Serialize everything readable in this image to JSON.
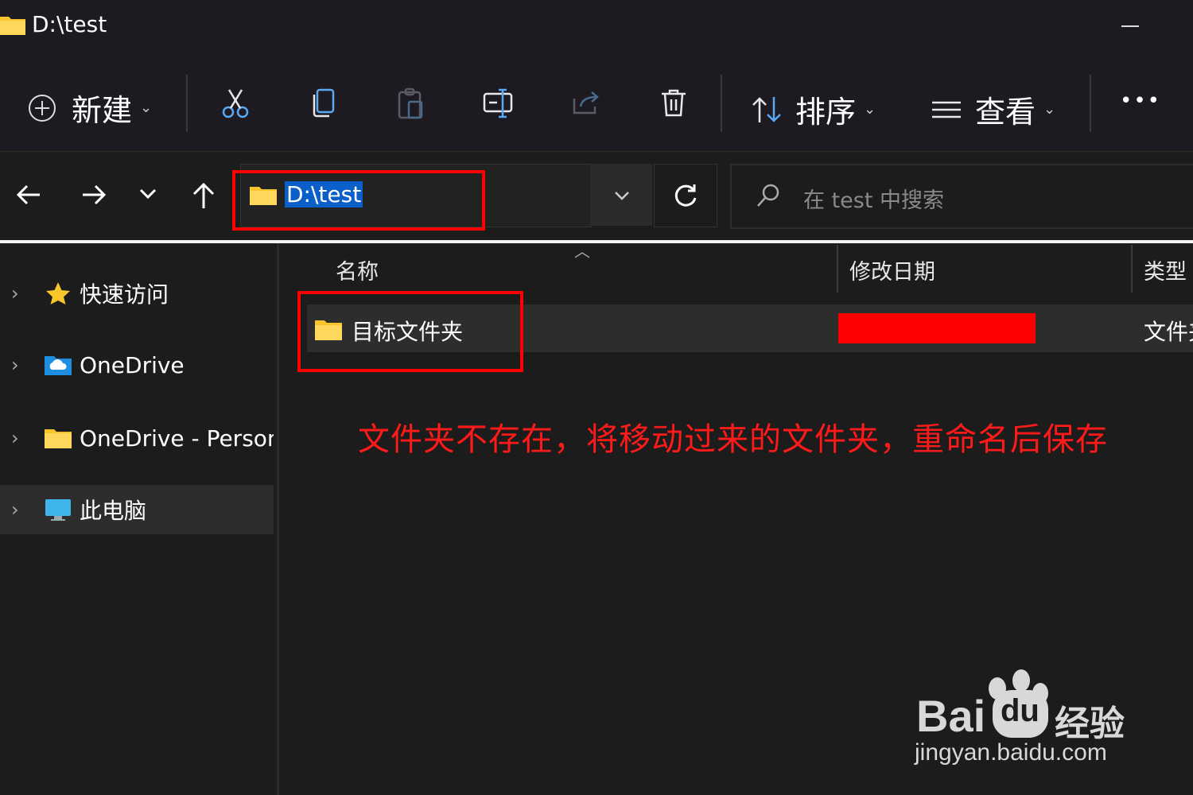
{
  "window": {
    "title": "D:\\test"
  },
  "toolbar": {
    "new_label": "新建",
    "sort_label": "排序",
    "view_label": "查看",
    "more_label": "•••",
    "icons": [
      "cut-icon",
      "copy-icon",
      "paste-icon",
      "rename-icon",
      "share-icon",
      "delete-icon"
    ]
  },
  "nav": {
    "address": "D:\\test",
    "search_placeholder": "在 test 中搜索"
  },
  "sidebar": {
    "items": [
      {
        "label": "快速访问",
        "icon": "star-icon"
      },
      {
        "label": "OneDrive",
        "icon": "onedrive-cloud-icon"
      },
      {
        "label": "OneDrive - Personal",
        "icon": "folder-icon"
      },
      {
        "label": "此电脑",
        "icon": "this-pc-icon"
      }
    ]
  },
  "columns": {
    "name": "名称",
    "date": "修改日期",
    "type": "类型"
  },
  "files": [
    {
      "name": "目标文件夹",
      "type": "文件夹"
    }
  ],
  "annotation": "文件夹不存在，将移动过来的文件夹，重命名后保存",
  "watermark": {
    "brand": "Bai",
    "brand_cn": "经验",
    "url": "jingyan.baidu.com"
  },
  "colors": {
    "highlight_red": "#ff0000",
    "selection_blue": "#0a5fc9",
    "folder_yellow": "#f8c62a",
    "background": "#1c1c1c"
  }
}
